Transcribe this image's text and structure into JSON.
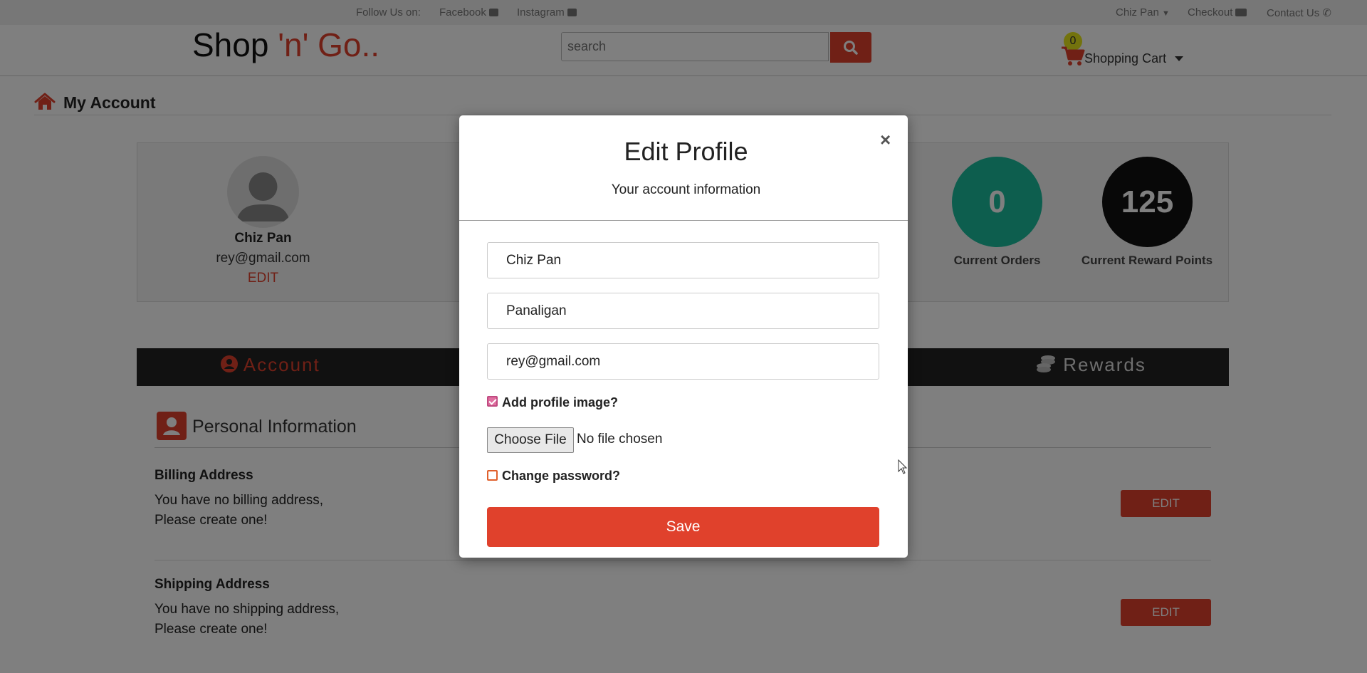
{
  "topbar": {
    "follow_label": "Follow Us on:",
    "facebook": "Facebook",
    "instagram": "Instagram",
    "user_menu": "Chiz Pan",
    "checkout": "Checkout",
    "contact": "Contact Us"
  },
  "header": {
    "logo_main": "Shop ",
    "logo_accent": "'n' Go..",
    "search_placeholder": "search",
    "cart_count": "0",
    "cart_label": "Shopping Cart"
  },
  "page": {
    "title": "My Account"
  },
  "profile": {
    "name": "Chiz Pan",
    "email": "rey@gmail.com",
    "edit_label": "EDIT",
    "current_orders_value": "0",
    "current_orders_label": "Current Orders",
    "reward_points_value": "125",
    "reward_points_label": "Current Reward Points"
  },
  "tabs": {
    "account": "Account",
    "rewards": "Rewards"
  },
  "personal_info": {
    "title": "Personal Information",
    "billing_title": "Billing Address",
    "billing_line1": "You have no billing address,",
    "billing_line2": "Please create one!",
    "billing_edit": "EDIT",
    "shipping_title": "Shipping Address",
    "shipping_line1": "You have no shipping address,",
    "shipping_line2": "Please create one!",
    "shipping_edit": "EDIT"
  },
  "modal": {
    "title": "Edit Profile",
    "close": "×",
    "subtitle": "Your account information",
    "first_name": "Chiz Pan",
    "last_name": "Panaligan",
    "email": "rey@gmail.com",
    "add_image_label": "Add profile image?",
    "add_image_checked": true,
    "choose_file": "Choose File",
    "no_file": "No file chosen",
    "change_password_label": "Change password?",
    "change_password_checked": false,
    "save": "Save"
  },
  "colors": {
    "accent": "#e0412c",
    "orders_circle": "#1abc9c",
    "points_circle": "#111111",
    "tabbar": "#222222"
  }
}
